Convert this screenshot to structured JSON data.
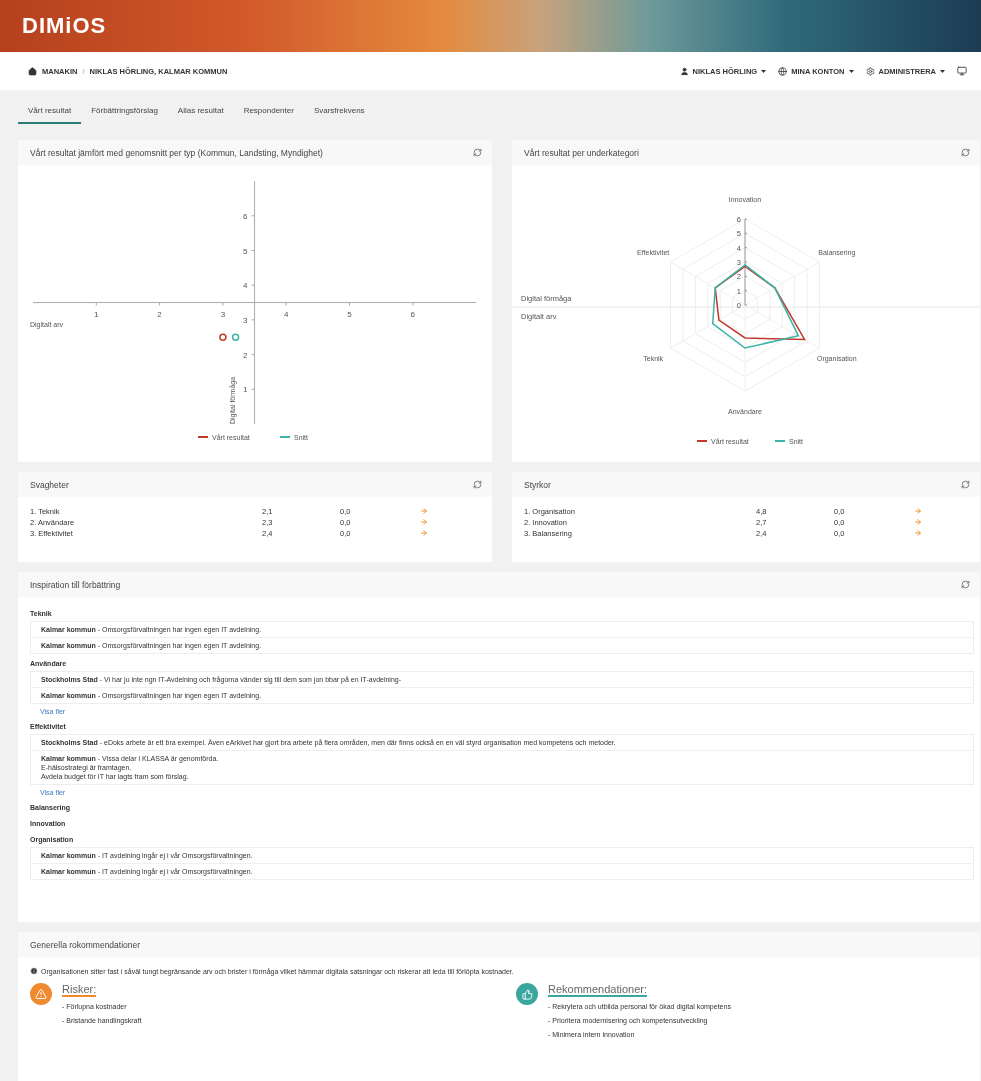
{
  "header": {
    "logo": "DIMiOS"
  },
  "breadcrumb": {
    "items": [
      "MANAKIN",
      "NIKLAS HÖRLING, KALMAR KOMMUN"
    ],
    "separator": "/"
  },
  "user_menu": [
    {
      "kind": "user",
      "label": "NIKLAS HÖRLING"
    },
    {
      "kind": "globe",
      "label": "MINA KONTON"
    },
    {
      "kind": "gear",
      "label": "ADMINISTRERA"
    },
    {
      "kind": "screen"
    }
  ],
  "tabs": [
    {
      "label": "Vårt resultat",
      "selected": true
    },
    {
      "label": "Förbättringsförslag",
      "selected": false
    },
    {
      "label": "Allas resultat",
      "selected": false
    },
    {
      "label": "Respondenter",
      "selected": false
    },
    {
      "label": "Svarsfrekvens",
      "selected": false
    }
  ],
  "scatter_card": {
    "title": "Vårt resultat jämfört med genomsnitt per typ (Kommun, Landsting, Myndighet)",
    "chart_data": {
      "type": "scatter",
      "xlabel": "Digitalt arv",
      "ylabel": "Digital förmåga",
      "legend": true,
      "xlim": [
        0,
        7
      ],
      "ylim": [
        0,
        7
      ],
      "xticks": [
        1,
        2,
        3,
        4,
        5,
        6
      ],
      "yticks": [
        1,
        2,
        3,
        4,
        5,
        6
      ],
      "x": [
        3.0,
        3.2
      ],
      "series": [
        {
          "name": "Vårt resultat",
          "color": "#c0392b",
          "values": [
            2.5,
            null
          ]
        },
        {
          "name": "Snitt",
          "color": "#3bb3a8",
          "values": [
            null,
            2.5
          ]
        }
      ]
    }
  },
  "radar_card": {
    "title": "Vårt resultat per underkategori",
    "zone_labels": [
      "Digital förmåga",
      "Digitalt arv"
    ],
    "chart_data": {
      "type": "radar",
      "categories": [
        "Innovation",
        "Balansering",
        "Organisation",
        "Användare",
        "Teknik",
        "Effektivitet"
      ],
      "legend": true,
      "ylim": [
        0,
        6
      ],
      "yticks": [
        0,
        1,
        2,
        3,
        4,
        5,
        6
      ],
      "series": [
        {
          "name": "Vårt resultat",
          "color": "#c0392b",
          "values": [
            2.7,
            2.4,
            4.8,
            2.3,
            2.1,
            2.4
          ]
        },
        {
          "name": "Snitt",
          "color": "#3bb3a8",
          "values": [
            2.8,
            2.4,
            4.3,
            3.0,
            2.6,
            2.4
          ]
        }
      ]
    }
  },
  "score_cards": [
    {
      "title": "Svagheter",
      "rows": [
        {
          "label": "1. Teknik",
          "column_2": "2,1",
          "column_3": "0,0"
        },
        {
          "label": "2. Användare",
          "column_2": "2,3",
          "column_3": "0,0"
        },
        {
          "label": "3. Effektivitet",
          "column_2": "2,4",
          "column_3": "0,0"
        }
      ]
    },
    {
      "title": "Styrkor",
      "rows": [
        {
          "label": "1. Organisation",
          "column_2": "4,8",
          "column_3": "0,0"
        },
        {
          "label": "2. Innovation",
          "column_2": "2,7",
          "column_3": "0,0"
        },
        {
          "label": "3. Balansering",
          "column_2": "2,4",
          "column_3": "0,0"
        }
      ]
    }
  ],
  "inspiration": {
    "title": "Inspiration till förbättring",
    "groups": [
      {
        "category": "Teknik",
        "entries": [
          {
            "lines": [
              "**Kalmar kommun** - Omsorgsförvaltningen har ingen egen IT avdelning."
            ]
          },
          {
            "lines": [
              "**Kalmar kommun** - Omsorgsförvaltningen har ingen egen IT avdelning."
            ]
          }
        ]
      },
      {
        "category": "Användare",
        "entries": [
          {
            "lines": [
              "**Stockholms Stad** - Vi har ju inte ngn IT-Avdelning och frågorna vänder sig till dem som jon bbar på en IT-avdelning-"
            ]
          },
          {
            "lines": [
              "**Kalmar kommun** - Omsorgsförvaltningen har ingen egen IT avdelning."
            ]
          }
        ],
        "more": "Visa fler"
      },
      {
        "category": "Effektivitet",
        "entries": [
          {
            "lines": [
              "**Stockholms Stad** - eDoks arbete är ett bra exempel. Även eArkivet har gjort bra arbete på flera områden, men där finns också en en väl styrd organisation med kompetens och metoder."
            ]
          },
          {
            "lines": [
              "**Kalmar kommun** - Vissa delar i KLASSA är genomförda.",
              "E-hälsostrategi är framtagen.",
              "Avdela budget för IT har lagts fram som förslag."
            ]
          }
        ],
        "more": "Visa fler"
      },
      {
        "category": "Balansering"
      },
      {
        "category": "Innovation"
      },
      {
        "category": "Organisation",
        "entries": [
          {
            "lines": [
              "**Kalmar kommun** - IT avdelning ingår ej i vår Omsorgsförvaltningen."
            ]
          },
          {
            "lines": [
              "**Kalmar kommun** - IT avdelning ingår ej i vår Omsorgsförvaltningen."
            ]
          }
        ]
      }
    ]
  },
  "recommendations": {
    "title": "Generella rokommendationer",
    "info": "Organisationen sitter fast i såväl tungt begränsande arv och brister i förmåga vilket hämmar digitala satsningar och riskerar att leda till förlöpta kostnader.",
    "columns": [
      {
        "kind": "risk",
        "heading": "Risker:",
        "items": [
          "- Förlupna kostnader",
          "- Bristande handlingskraft"
        ]
      },
      {
        "kind": "recommendation",
        "heading": "Rekommendationer:",
        "items": [
          "- Rekrytera och utbilda personal för ökad digital kompetens",
          "- Prioritera modernisering och kompetensutveckling",
          "- Minimera intern innovation"
        ]
      }
    ]
  }
}
